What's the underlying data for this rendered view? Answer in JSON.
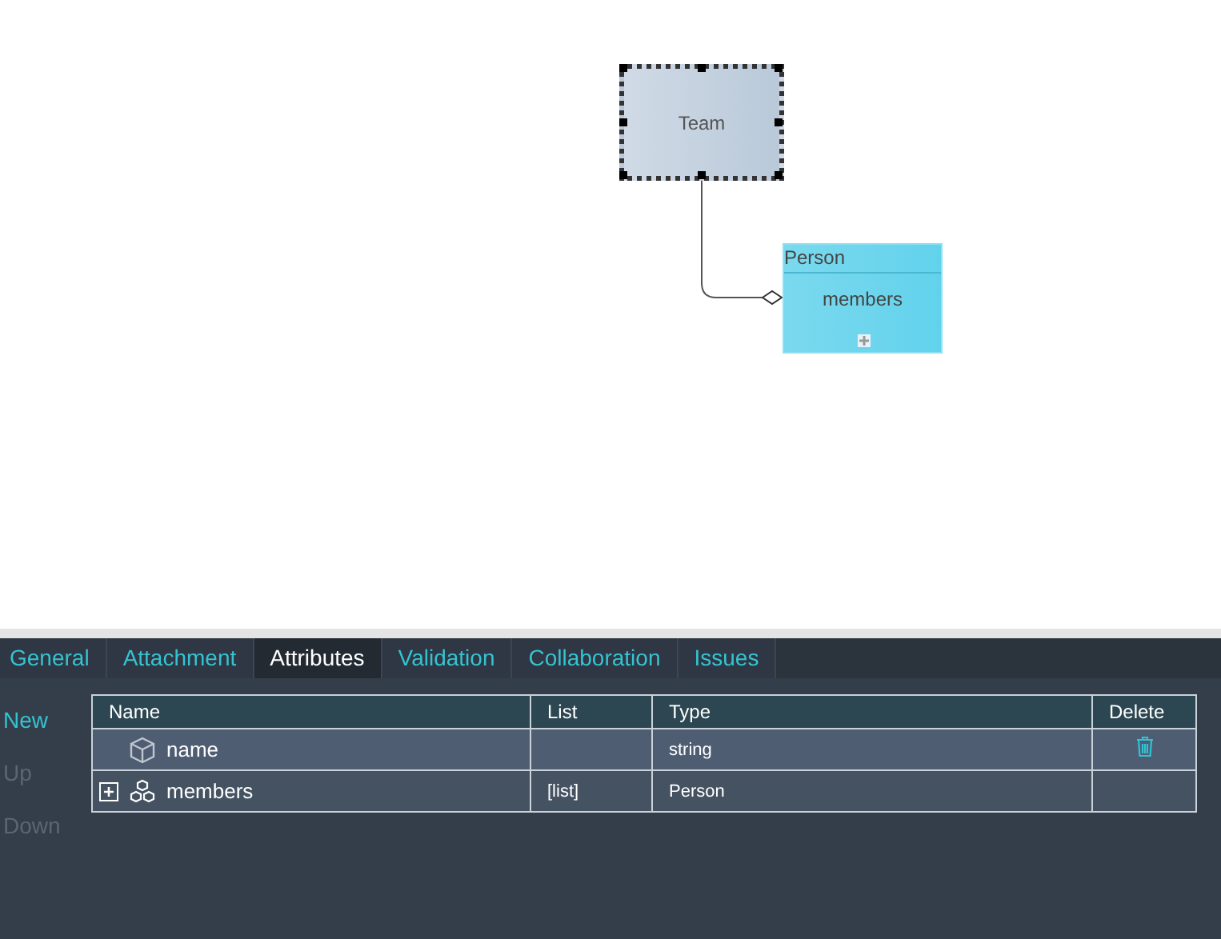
{
  "diagram": {
    "nodes": [
      {
        "kind": "class",
        "title": "Team",
        "selected": true
      },
      {
        "kind": "class-header",
        "title": "Person",
        "attribute": "members",
        "selected": false
      }
    ]
  },
  "tabs": [
    {
      "label": "General",
      "selected": false
    },
    {
      "label": "Attachment",
      "selected": false
    },
    {
      "label": "Attributes",
      "selected": true
    },
    {
      "label": "Validation",
      "selected": false
    },
    {
      "label": "Collaboration",
      "selected": false
    },
    {
      "label": "Issues",
      "selected": false
    }
  ],
  "actions": [
    {
      "label": "New",
      "disabled": false
    },
    {
      "label": "Up",
      "disabled": true
    },
    {
      "label": "Down",
      "disabled": true
    }
  ],
  "table": {
    "columns": [
      "Name",
      "List",
      "Type",
      "Delete"
    ],
    "rows": [
      {
        "kind": "attribute",
        "name": "name",
        "list": "",
        "type": "string",
        "selected": true,
        "deletable": true,
        "expandable": false
      },
      {
        "kind": "association",
        "name": "members",
        "list": "[list]",
        "type": "Person",
        "selected": false,
        "deletable": false,
        "expandable": true
      }
    ]
  }
}
